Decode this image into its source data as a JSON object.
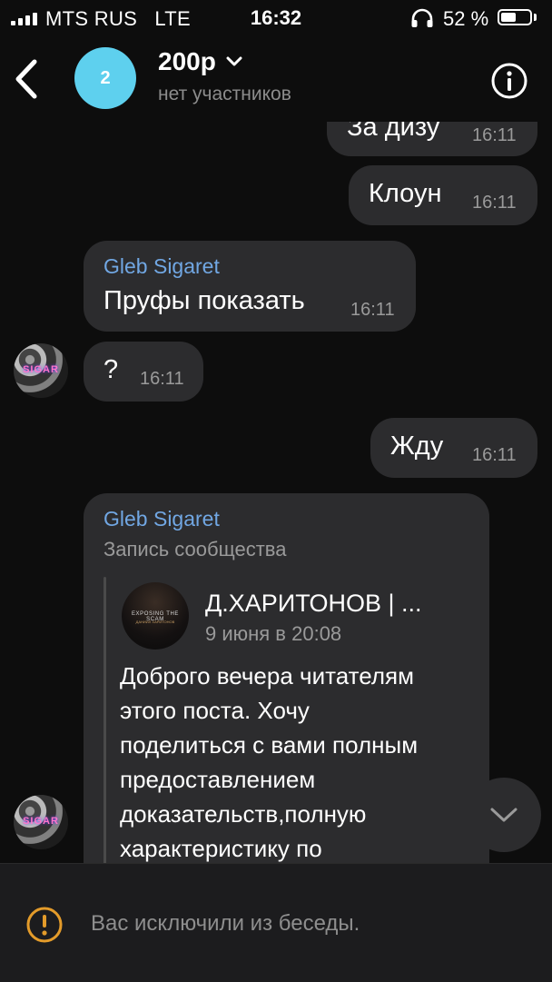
{
  "status_bar": {
    "carrier": "MTS RUS",
    "network": "LTE",
    "time": "16:32",
    "battery": "52 %",
    "battery_level": 0.52
  },
  "header": {
    "avatar_letter": "2",
    "avatar_color": "#5ed0ee",
    "title": "200р",
    "subtitle": "нет участников"
  },
  "messages": [
    {
      "text": "За дизу",
      "time": "16:11"
    },
    {
      "text": "Клоун",
      "time": "16:11"
    },
    {
      "author": "Gleb Sigaret",
      "text": "Пруфы показать",
      "time": "16:11"
    },
    {
      "text": "?",
      "time": "16:11"
    },
    {
      "text": "Жду",
      "time": "16:11"
    }
  ],
  "avatar_label": "SIGAR",
  "repost": {
    "author": "Gleb Sigaret",
    "kind": "Запись сообщества",
    "thumb_line1": "EXPOSING THE SCAM",
    "thumb_line2": "ДАНИИЛ ХАРИТОНОВ",
    "source_name": "Д.ХАРИТОНОВ | ...",
    "date": "9 июня в 20:08",
    "lines": [
      "Доброго вечера читателям",
      "этого поста. Хочу",
      "поделиться с вами полным",
      "предоставлением",
      "доказательств,полную",
      "характеристику по"
    ]
  },
  "bottom": {
    "notice": "Вас исключили из беседы."
  },
  "colors": {
    "background": "#0d0d0d",
    "bubble": "#2c2c2e",
    "author": "#71a7e3",
    "warning": "#e39b2a"
  }
}
